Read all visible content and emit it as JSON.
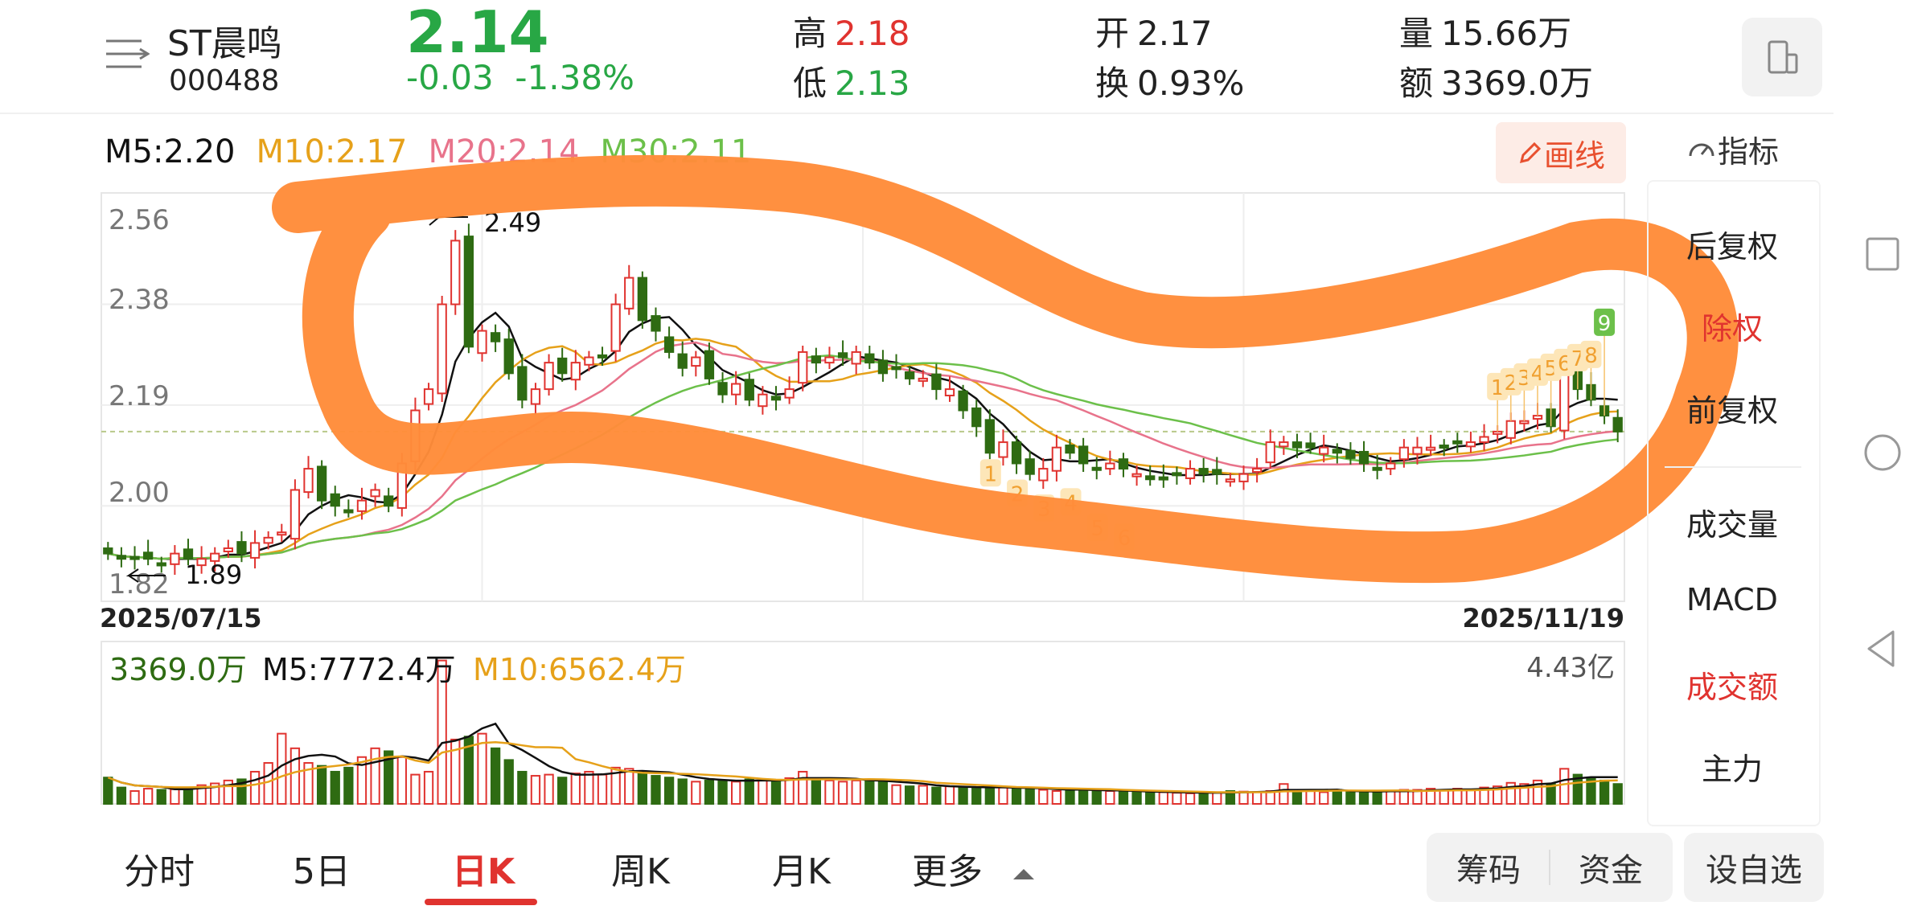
{
  "stock": {
    "name": "ST晨鸣",
    "code": "000488",
    "price": "2.14",
    "change": "-0.03",
    "change_pct": "-1.38%"
  },
  "stats": {
    "high_label": "高",
    "high": "2.18",
    "low_label": "低",
    "low": "2.13",
    "open_label": "开",
    "open": "2.17",
    "turnover_label": "换",
    "turnover": "0.93%",
    "volume_label": "量",
    "volume": "15.66万",
    "amount_label": "额",
    "amount": "3369.0万"
  },
  "ma_legend": {
    "ma5": "M5:2.20",
    "ma10": "M10:2.17",
    "ma20": "M20:2.14",
    "ma30": "M30:2.11"
  },
  "draw_button": "画线",
  "indicator_label": "指标",
  "side_menu": [
    "后复权",
    "除权",
    "前复权",
    "成交量",
    "MACD",
    "成交额",
    "主力"
  ],
  "tabs": [
    "分时",
    "5日",
    "日K",
    "周K",
    "月K",
    "更多"
  ],
  "active_tab": "日K",
  "bottom_buttons": {
    "chips": "筹码",
    "funds": "资金",
    "add_watch": "设自选"
  },
  "colors": {
    "up": "#e0332f",
    "down": "#2e6b12",
    "ma5": "#111111",
    "ma10": "#e6a11a",
    "ma20": "#e8738b",
    "ma30": "#6cc04a",
    "annotation": "#ff8c3a"
  },
  "chart_data": {
    "type": "candlestick",
    "date_start": "2025/07/15",
    "date_end": "2025/11/19",
    "y_ticks": [
      "2.56",
      "2.38",
      "2.19",
      "2.00",
      "1.82"
    ],
    "ylim": [
      1.82,
      2.59
    ],
    "max_marker": "2.49",
    "min_marker": "1.89",
    "volume_ymax_label": "4.43亿",
    "volume_legend": {
      "current": "3369.0万",
      "m5": "M5:7772.4万",
      "m10": "M10:6562.4万"
    },
    "td_sequential_down": [
      "1",
      "2",
      "3",
      "4",
      "5",
      "6"
    ],
    "td_sequential_up": [
      "1",
      "2",
      "3",
      "4",
      "5",
      "6",
      "7",
      "8",
      "9"
    ],
    "closes": [
      1.91,
      1.9,
      1.9,
      1.9,
      1.89,
      1.91,
      1.9,
      1.9,
      1.91,
      1.92,
      1.91,
      1.93,
      1.94,
      1.95,
      2.03,
      2.07,
      2.01,
      2.0,
      1.99,
      2.01,
      2.03,
      2.0,
      2.08,
      2.18,
      2.22,
      2.38,
      2.5,
      2.3,
      2.33,
      2.31,
      2.25,
      2.2,
      2.22,
      2.27,
      2.25,
      2.27,
      2.28,
      2.28,
      2.38,
      2.43,
      2.35,
      2.33,
      2.29,
      2.26,
      2.28,
      2.24,
      2.21,
      2.23,
      2.2,
      2.21,
      2.2,
      2.22,
      2.29,
      2.27,
      2.28,
      2.28,
      2.29,
      2.27,
      2.25,
      2.26,
      2.24,
      2.24,
      2.22,
      2.22,
      2.18,
      2.15,
      2.1,
      2.12,
      2.08,
      2.06,
      2.07,
      2.11,
      2.1,
      2.08,
      2.07,
      2.08,
      2.07,
      2.06,
      2.05,
      2.05,
      2.06,
      2.07,
      2.06,
      2.06,
      2.05,
      2.06,
      2.07,
      2.12,
      2.12,
      2.11,
      2.11,
      2.11,
      2.1,
      2.09,
      2.08,
      2.07,
      2.08,
      2.11,
      2.11,
      2.11,
      2.11,
      2.12,
      2.12,
      2.13,
      2.14,
      2.16,
      2.16,
      2.17,
      2.15,
      2.27,
      2.22,
      2.2,
      2.17,
      2.14
    ],
    "volumes": [
      0.45,
      0.28,
      0.22,
      0.26,
      0.24,
      0.25,
      0.28,
      0.32,
      0.35,
      0.4,
      0.42,
      0.55,
      0.7,
      1.2,
      0.95,
      0.7,
      0.65,
      0.55,
      0.62,
      0.8,
      0.95,
      0.9,
      0.8,
      0.5,
      0.55,
      2.45,
      1.1,
      1.15,
      1.2,
      0.95,
      0.75,
      0.55,
      0.48,
      0.5,
      0.45,
      0.52,
      0.55,
      0.5,
      0.62,
      0.6,
      0.55,
      0.48,
      0.45,
      0.42,
      0.38,
      0.4,
      0.4,
      0.38,
      0.42,
      0.4,
      0.4,
      0.44,
      0.55,
      0.42,
      0.4,
      0.38,
      0.4,
      0.42,
      0.38,
      0.32,
      0.3,
      0.31,
      0.28,
      0.3,
      0.28,
      0.26,
      0.3,
      0.28,
      0.26,
      0.26,
      0.24,
      0.22,
      0.24,
      0.26,
      0.22,
      0.22,
      0.2,
      0.21,
      0.2,
      0.2,
      0.19,
      0.18,
      0.18,
      0.2,
      0.22,
      0.21,
      0.2,
      0.22,
      0.34,
      0.22,
      0.22,
      0.2,
      0.24,
      0.22,
      0.2,
      0.2,
      0.22,
      0.24,
      0.24,
      0.26,
      0.24,
      0.26,
      0.24,
      0.28,
      0.3,
      0.36,
      0.34,
      0.4,
      0.34,
      0.6,
      0.5,
      0.44,
      0.4,
      0.34
    ]
  }
}
